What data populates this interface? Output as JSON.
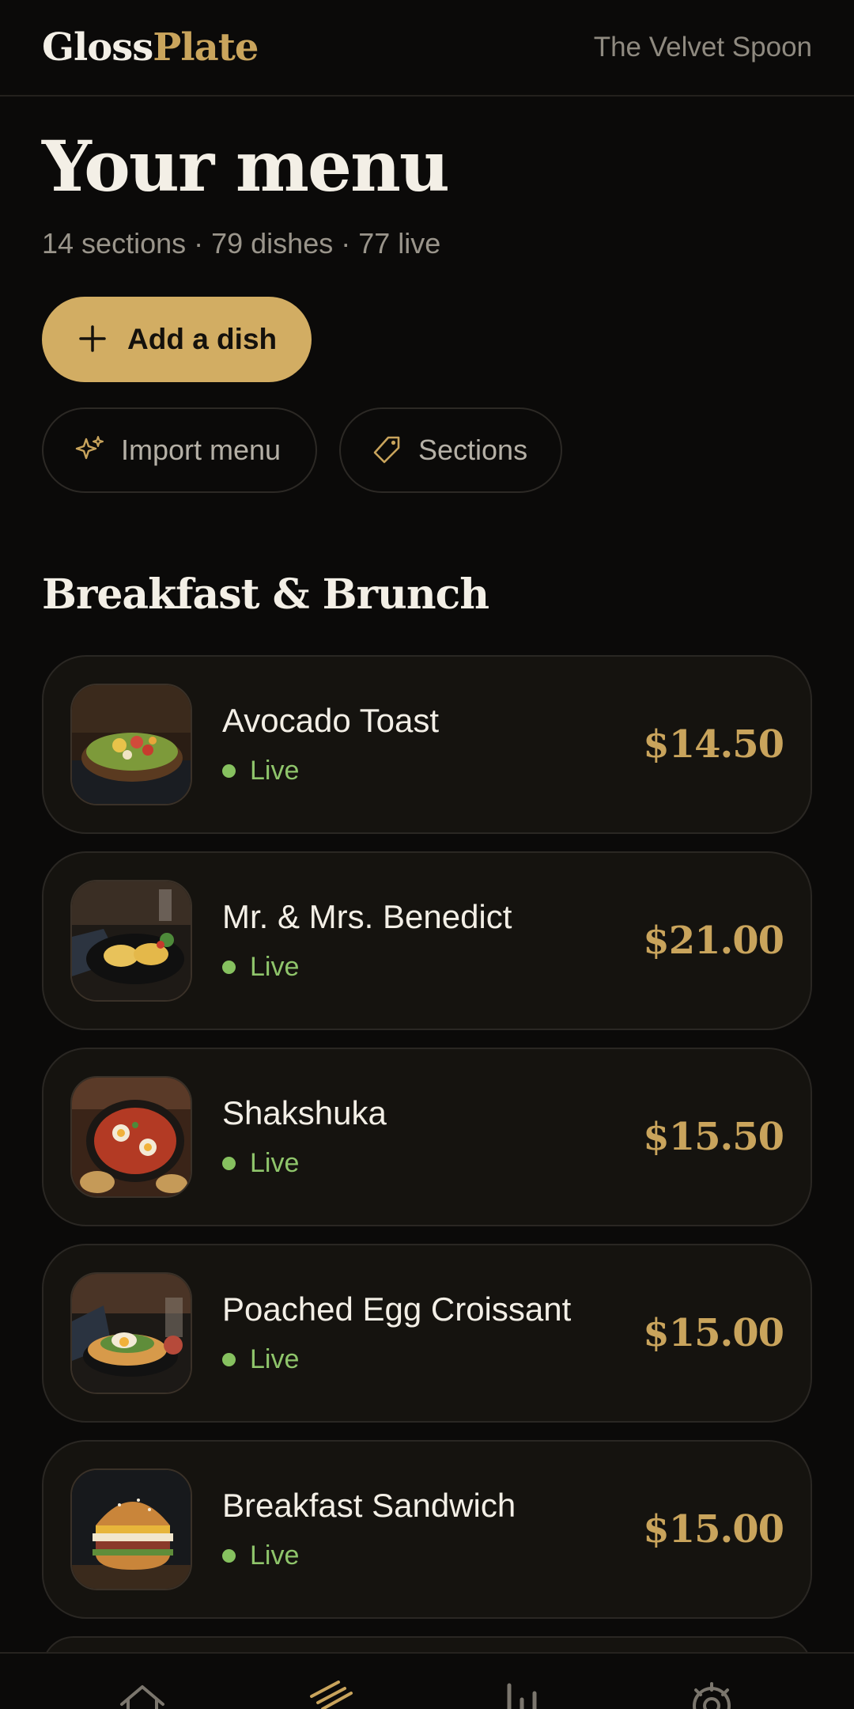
{
  "header": {
    "brand_part1": "Gloss",
    "brand_part2": "Plate",
    "restaurant_name": "The Velvet Spoon"
  },
  "main": {
    "title": "Your menu",
    "stats": "14 sections · 79 dishes · 77 live",
    "add_dish_label": "Add a dish",
    "add_dish_icon": "plus-icon",
    "import_menu_label": "Import menu",
    "import_menu_icon": "sparkle-icon",
    "sections_label": "Sections",
    "sections_icon": "tag-icon"
  },
  "section": {
    "title": "Breakfast & Brunch",
    "dishes": [
      {
        "name": "Avocado Toast",
        "status": "Live",
        "price": "$14.50"
      },
      {
        "name": "Mr. & Mrs. Benedict",
        "status": "Live",
        "price": "$21.00"
      },
      {
        "name": "Shakshuka",
        "status": "Live",
        "price": "$15.50"
      },
      {
        "name": "Poached Egg Croissant",
        "status": "Live",
        "price": "$15.00"
      },
      {
        "name": "Breakfast Sandwich",
        "status": "Live",
        "price": "$15.00"
      }
    ]
  },
  "bottom_nav": {
    "items": [
      {
        "icon": "home-icon",
        "active": false
      },
      {
        "icon": "fork-knife-icon",
        "active": true
      },
      {
        "icon": "bar-chart-icon",
        "active": false
      },
      {
        "icon": "gear-icon",
        "active": false
      }
    ]
  },
  "colors": {
    "background": "#0b0a09",
    "accent_gold": "#c9a45c",
    "button_gold": "#d2ad63",
    "live_green": "#86c15f",
    "card_bg": "#15130f"
  }
}
